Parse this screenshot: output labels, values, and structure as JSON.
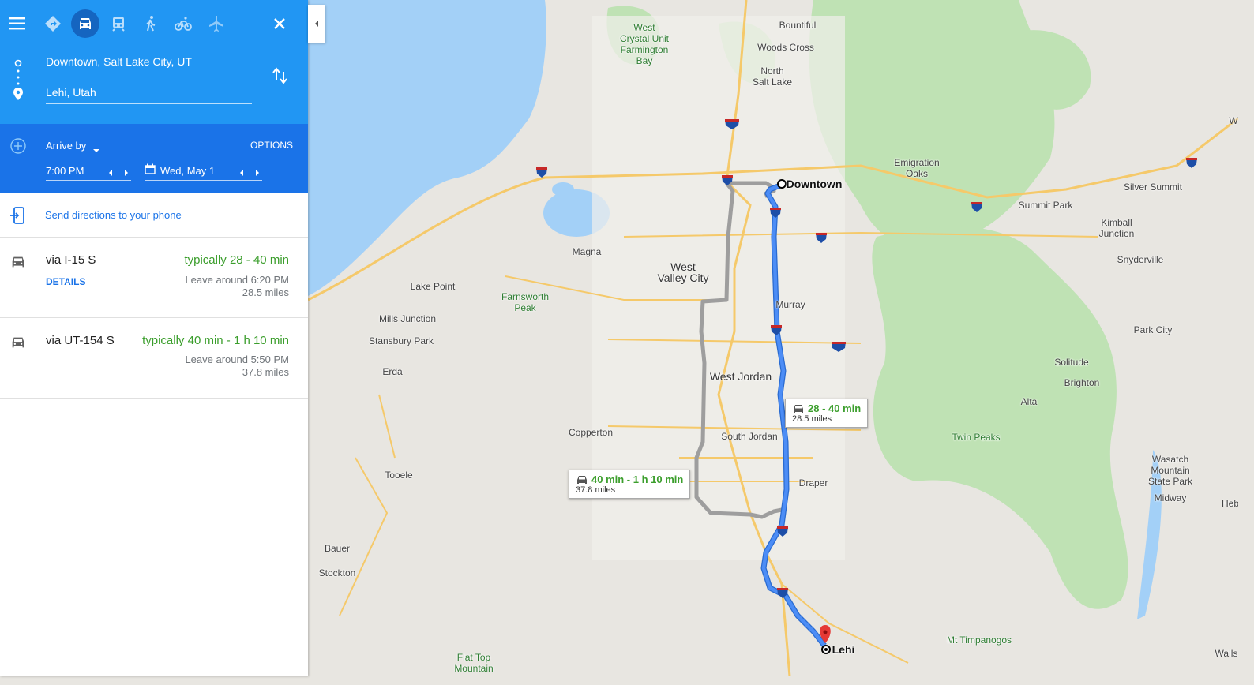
{
  "travel_modes": [
    {
      "name": "best",
      "icon": "directions-icon"
    },
    {
      "name": "driving",
      "icon": "car-icon",
      "active": true
    },
    {
      "name": "transit",
      "icon": "train-icon"
    },
    {
      "name": "walking",
      "icon": "walk-icon"
    },
    {
      "name": "cycling",
      "icon": "bike-icon"
    },
    {
      "name": "flights",
      "icon": "plane-icon"
    }
  ],
  "inputs": {
    "origin": "Downtown, Salt Lake City, UT",
    "destination": "Lehi, Utah"
  },
  "schedule": {
    "mode_label": "Arrive by",
    "options_label": "OPTIONS",
    "time": "7:00 PM",
    "date": "Wed, May 1"
  },
  "send_phone": "Send directions to your phone",
  "routes": [
    {
      "name": "via I-15 S",
      "time": "typically 28 - 40 min",
      "details": "DETAILS",
      "leave": "Leave around 6:20 PM",
      "distance": "28.5 miles"
    },
    {
      "name": "via UT-154 S",
      "time": "typically 40 min - 1 h 10 min",
      "leave": "Leave around 5:50 PM",
      "distance": "37.8 miles"
    }
  ],
  "map": {
    "callouts": [
      {
        "time": "28 - 40 min",
        "distance": "28.5 miles"
      },
      {
        "time": "40 min - 1 h 10 min",
        "distance": "37.8 miles"
      }
    ],
    "places": {
      "west_crystal": "West\nCrystal Unit\nFarmington\nBay",
      "bountiful": "Bountiful",
      "woods_cross": "Woods Cross",
      "north_salt_lake": "North\nSalt Lake",
      "downtown": "Downtown",
      "emigration_oaks": "Emigration\nOaks",
      "silver_summit": "Silver Summit",
      "summit_park": "Summit Park",
      "kimball_junction": "Kimball\nJunction",
      "snyderville": "Snyderville",
      "magna": "Magna",
      "west_valley_city": "West\nValley City",
      "murray": "Murray",
      "lake_point": "Lake Point",
      "farnsworth_peak": "Farnsworth\nPeak",
      "mills_junction": "Mills Junction",
      "stansbury_park": "Stansbury Park",
      "park_city": "Park City",
      "solitude": "Solitude",
      "brighton": "Brighton",
      "erda": "Erda",
      "west_jordan": "West Jordan",
      "alta": "Alta",
      "copperton": "Copperton",
      "south_jordan": "South Jordan",
      "twin_peaks": "Twin Peaks",
      "wasatch": "Wasatch\nMountain\nState Park",
      "tooele": "Tooele",
      "draper": "Draper",
      "midway": "Midway",
      "bauer": "Bauer",
      "stockton": "Stockton",
      "lehi": "Lehi",
      "mt_timpanogos": "Mt Timpanogos",
      "flat_top": "Flat Top\nMountain",
      "heb": "Heb",
      "walls": "Walls",
      "w_edge": "W"
    }
  },
  "colors": {
    "panel_blue": "#1a73e8",
    "route_blue": "#4285f4",
    "route_gray": "#9e9e9e",
    "green_time": "#3b9e2c"
  }
}
